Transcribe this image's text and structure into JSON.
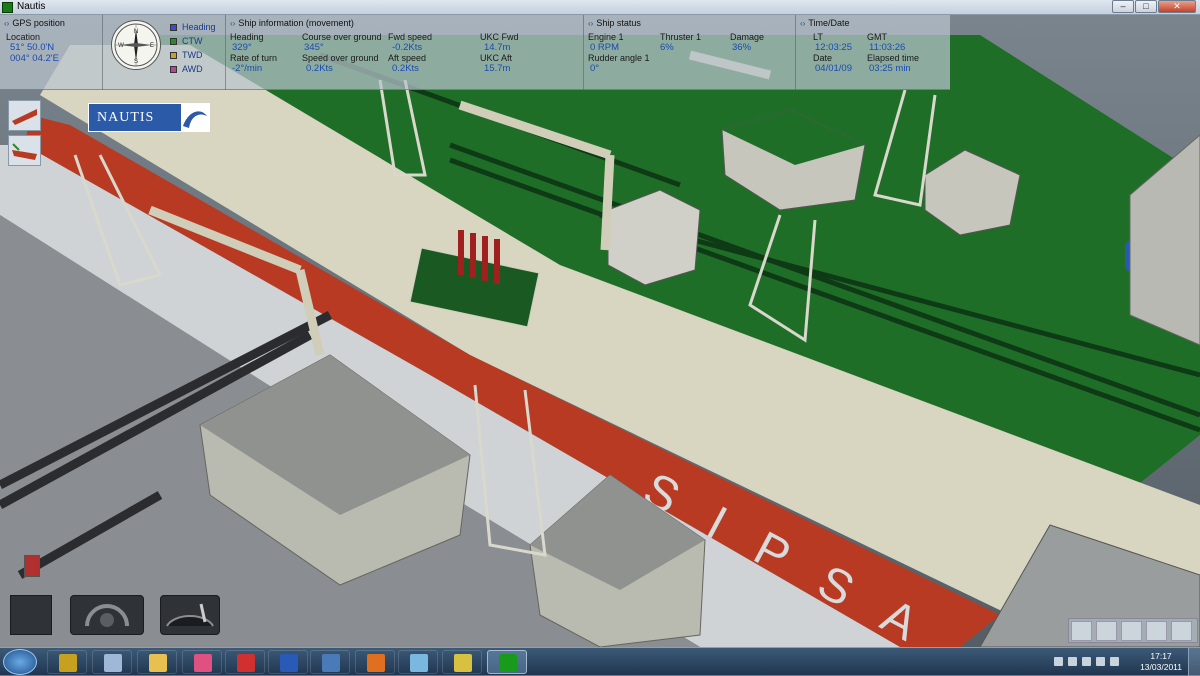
{
  "window": {
    "title": "Nautis"
  },
  "hud": {
    "gps": {
      "header": "GPS position",
      "location_label": "Location",
      "lat": "51° 50.0'N",
      "lon": "004° 04.2'E"
    },
    "compass": {
      "n": "N",
      "e": "E",
      "s": "S",
      "w": "W"
    },
    "legend": [
      {
        "label": "Heading",
        "color": "#3a4ec8"
      },
      {
        "label": "CTW",
        "color": "#2a8a2a"
      },
      {
        "label": "TWD",
        "color": "#c8a030"
      },
      {
        "label": "AWD",
        "color": "#c040a0"
      }
    ],
    "ship_info": {
      "header": "Ship information (movement)",
      "heading_label": "Heading",
      "heading": "329°",
      "cog_label": "Course over ground",
      "cog": "345°",
      "fwd_speed_label": "Fwd speed",
      "fwd_speed": "-0.2Kts",
      "ukc_fwd_label": "UKC Fwd",
      "ukc_fwd": "14.7m",
      "rot_label": "Rate of turn",
      "rot": "-2°/min",
      "sog_label": "Speed over ground",
      "sog": "0.2Kts",
      "aft_speed_label": "Aft speed",
      "aft_speed": "0.2Kts",
      "ukc_aft_label": "UKC Aft",
      "ukc_aft": "15.7m"
    },
    "ship_status": {
      "header": "Ship status",
      "engine_label": "Engine 1",
      "engine": "0 RPM",
      "thruster_label": "Thruster 1",
      "thruster": "6%",
      "damage_label": "Damage",
      "damage": "36%",
      "rudder_label": "Rudder angle 1",
      "rudder": "0°"
    },
    "time": {
      "header": "Time/Date",
      "lt_label": "LT",
      "lt": "12:03:25",
      "gmt_label": "GMT",
      "gmt": "11:03:26",
      "date_label": "Date",
      "date": "04/01/09",
      "elapsed_label": "Elapsed time",
      "elapsed": "03:25 min"
    }
  },
  "logo": {
    "text": "NAUTIS"
  },
  "hull_text": "SIPSA",
  "taskbar": {
    "items": [
      {
        "name": "media-icon",
        "color": "#c8a020"
      },
      {
        "name": "calculator-icon",
        "color": "#9fb8d8"
      },
      {
        "name": "folder-icon",
        "color": "#e8c050"
      },
      {
        "name": "paint-icon",
        "color": "#e05080"
      },
      {
        "name": "acrobat-icon",
        "color": "#d03030"
      },
      {
        "name": "word-icon",
        "color": "#2a5ab8"
      },
      {
        "name": "thunderbird-icon",
        "color": "#4a7ab8"
      },
      {
        "name": "firefox-icon",
        "color": "#e07020"
      },
      {
        "name": "notepad-icon",
        "color": "#7ab8e0"
      },
      {
        "name": "network-icon",
        "color": "#d8c040"
      },
      {
        "name": "nautis-app-icon",
        "color": "#1a9a1a"
      }
    ],
    "clock": {
      "time": "17:17",
      "date": "13/03/2011"
    }
  }
}
